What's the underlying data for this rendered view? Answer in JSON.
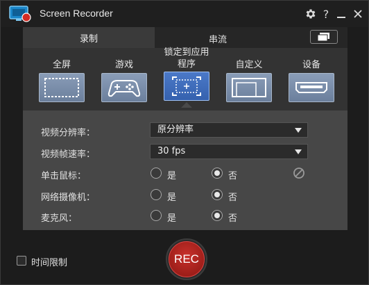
{
  "window": {
    "title": "Screen Recorder"
  },
  "titlebar": {
    "help_glyph": "?",
    "minimize_glyph": "—",
    "close_glyph": "✕"
  },
  "tabs": [
    {
      "label": "录制",
      "selected": true
    },
    {
      "label": "串流",
      "selected": false
    }
  ],
  "modes": [
    {
      "label": "全屏",
      "icon": "fullscreen-icon",
      "active": false
    },
    {
      "label": "游戏",
      "icon": "gamepad-icon",
      "active": false
    },
    {
      "label": "锁定到应用程序",
      "icon": "lock-to-app-icon",
      "active": true
    },
    {
      "label": "自定义",
      "icon": "custom-region-icon",
      "active": false
    },
    {
      "label": "设备",
      "icon": "hdmi-device-icon",
      "active": false
    }
  ],
  "settings": {
    "resolution": {
      "label": "视频分辨率：",
      "value": "原分辨率"
    },
    "framerate": {
      "label": "视频帧速率：",
      "value": "30 fps"
    },
    "click": {
      "label": "单击鼠标：",
      "yes": "是",
      "no": "否",
      "selected": "no"
    },
    "webcam": {
      "label": "网络摄像机：",
      "yes": "是",
      "no": "否",
      "selected": "no"
    },
    "mic": {
      "label": "麦克风：",
      "yes": "是",
      "no": "否",
      "selected": "no"
    }
  },
  "bottom": {
    "time_limit_label": "时间限制",
    "time_limit_checked": false,
    "rec_label": "REC"
  },
  "colors": {
    "accent_blue": "#3f6fc0",
    "rec_red": "#b3221d",
    "panel": "#474747"
  }
}
